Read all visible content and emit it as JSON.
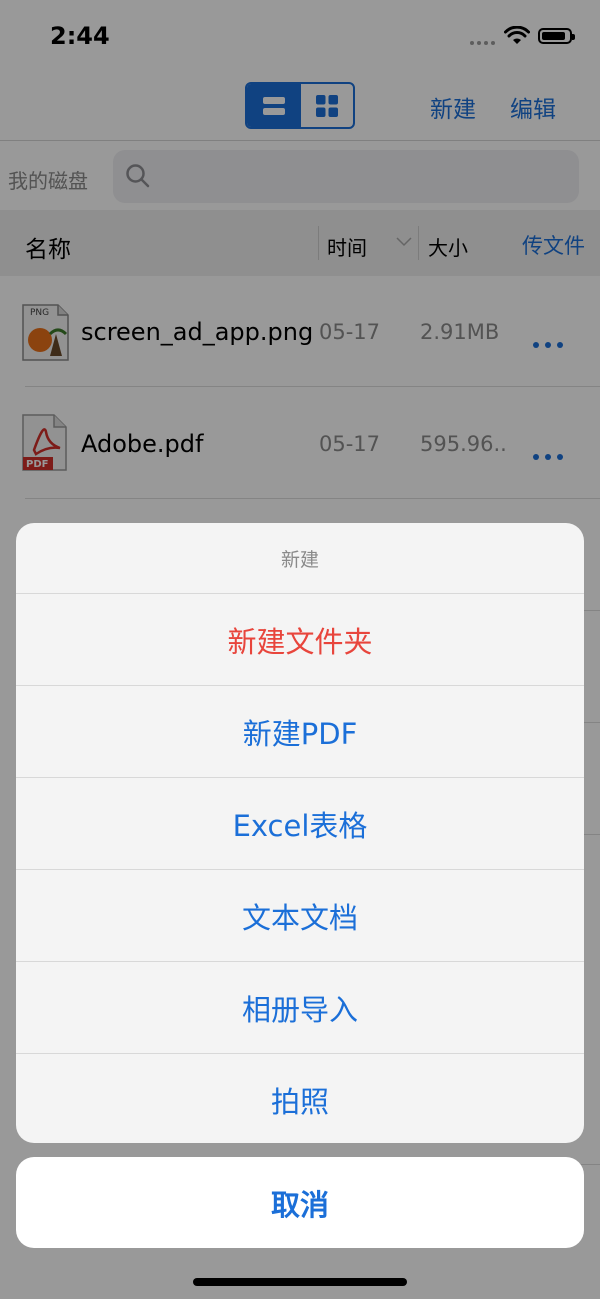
{
  "status_bar": {
    "time": "2:44",
    "battery_level": 0.9
  },
  "nav": {
    "new_label": "新建",
    "edit_label": "编辑",
    "list_view_icon": "list-icon",
    "grid_view_icon": "grid-icon"
  },
  "search": {
    "location_label": "我的磁盘",
    "placeholder": ""
  },
  "columns": {
    "name": "名称",
    "time": "时间",
    "size": "大小",
    "upload": "传文件"
  },
  "files": [
    {
      "name": "screen_ad_app.png",
      "date": "05-17",
      "size": "2.91MB",
      "icon": "png-file-icon"
    },
    {
      "name": "Adobe.pdf",
      "date": "05-17",
      "size": "595.96..",
      "icon": "pdf-file-icon"
    }
  ],
  "action_sheet": {
    "title": "新建",
    "items": [
      {
        "label": "新建文件夹"
      },
      {
        "label": "新建PDF"
      },
      {
        "label": "Excel表格"
      },
      {
        "label": "文本文档"
      },
      {
        "label": "相册导入"
      },
      {
        "label": "拍照"
      }
    ],
    "cancel_label": "取消"
  },
  "colors": {
    "accent": "#1b6fd8",
    "destructive": "#e8453c"
  }
}
